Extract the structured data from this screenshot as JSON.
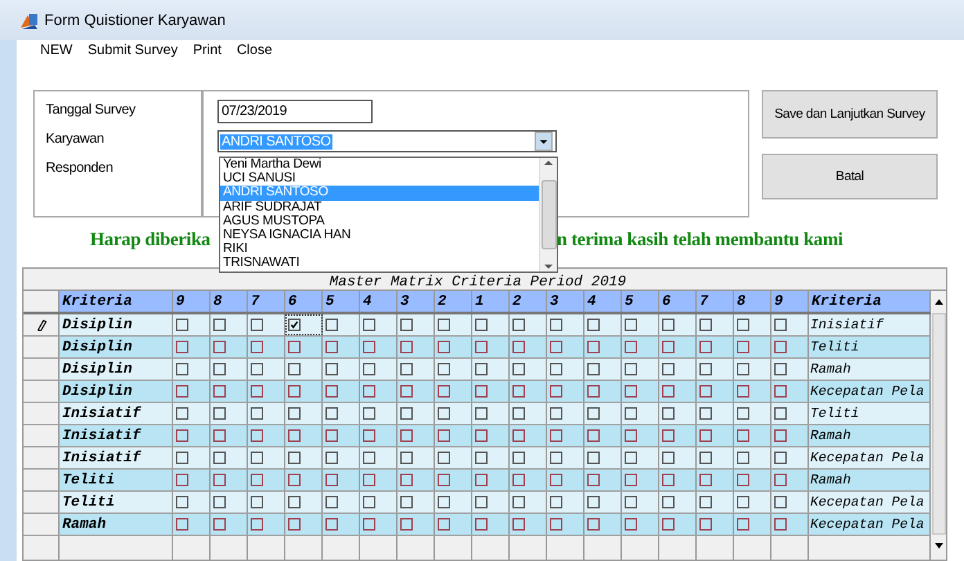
{
  "window": {
    "title": "Form Quistioner Karyawan"
  },
  "menu": [
    "NEW",
    "Submit Survey",
    "Print",
    "Close"
  ],
  "form": {
    "tanggal_survey": {
      "label": "Tanggal Survey",
      "value": "07/23/2019"
    },
    "karyawan": {
      "label": "Karyawan",
      "value": "ANDRI SANTOSO",
      "expanded": true,
      "options": [
        {
          "label": "Yeni Martha Dewi",
          "selected": false
        },
        {
          "label": "UCI SANUSI",
          "selected": false
        },
        {
          "label": "ANDRI SANTOSO",
          "selected": true
        },
        {
          "label": "ARIF SUDRAJAT",
          "selected": false
        },
        {
          "label": "AGUS MUSTOPA",
          "selected": false
        },
        {
          "label": "NEYSA IGNACIA HAN",
          "selected": false
        },
        {
          "label": "RIKI",
          "selected": false
        },
        {
          "label": "TRISNAWATI",
          "selected": false
        }
      ]
    },
    "responden": {
      "label": "Responden"
    }
  },
  "buttons": [
    "Save dan Lanjutkan Survey",
    "Batal"
  ],
  "message": [
    "Harap diberika",
    "n terima kasih telah membantu kami"
  ],
  "grid": {
    "title": "Master Matrix Criteria Period 2019",
    "columns": [
      "Kriteria",
      "9",
      "8",
      "7",
      "6",
      "5",
      "4",
      "3",
      "2",
      "1",
      "2",
      "3",
      "4",
      "5",
      "6",
      "7",
      "8",
      "9",
      "Kriteria"
    ],
    "rows": [
      {
        "left": "Disiplin",
        "right": "Inisiatif",
        "editing": true,
        "checks": [
          false,
          false,
          false,
          true,
          false,
          false,
          false,
          false,
          false,
          false,
          false,
          false,
          false,
          false,
          false,
          false,
          false
        ]
      },
      {
        "left": "Disiplin",
        "right": "Teliti",
        "editing": false,
        "checks": [
          false,
          false,
          false,
          false,
          false,
          false,
          false,
          false,
          false,
          false,
          false,
          false,
          false,
          false,
          false,
          false,
          false
        ]
      },
      {
        "left": "Disiplin",
        "right": "Ramah",
        "editing": false,
        "checks": [
          false,
          false,
          false,
          false,
          false,
          false,
          false,
          false,
          false,
          false,
          false,
          false,
          false,
          false,
          false,
          false,
          false
        ]
      },
      {
        "left": "Disiplin",
        "right": "Kecepatan Pela",
        "editing": false,
        "checks": [
          false,
          false,
          false,
          false,
          false,
          false,
          false,
          false,
          false,
          false,
          false,
          false,
          false,
          false,
          false,
          false,
          false
        ]
      },
      {
        "left": "Inisiatif",
        "right": "Teliti",
        "editing": false,
        "checks": [
          false,
          false,
          false,
          false,
          false,
          false,
          false,
          false,
          false,
          false,
          false,
          false,
          false,
          false,
          false,
          false,
          false
        ]
      },
      {
        "left": "Inisiatif",
        "right": "Ramah",
        "editing": false,
        "checks": [
          false,
          false,
          false,
          false,
          false,
          false,
          false,
          false,
          false,
          false,
          false,
          false,
          false,
          false,
          false,
          false,
          false
        ]
      },
      {
        "left": "Inisiatif",
        "right": "Kecepatan Pela",
        "editing": false,
        "checks": [
          false,
          false,
          false,
          false,
          false,
          false,
          false,
          false,
          false,
          false,
          false,
          false,
          false,
          false,
          false,
          false,
          false
        ]
      },
      {
        "left": "Teliti",
        "right": "Ramah",
        "editing": false,
        "checks": [
          false,
          false,
          false,
          false,
          false,
          false,
          false,
          false,
          false,
          false,
          false,
          false,
          false,
          false,
          false,
          false,
          false
        ]
      },
      {
        "left": "Teliti",
        "right": "Kecepatan Pela",
        "editing": false,
        "checks": [
          false,
          false,
          false,
          false,
          false,
          false,
          false,
          false,
          false,
          false,
          false,
          false,
          false,
          false,
          false,
          false,
          false
        ]
      },
      {
        "left": "Ramah",
        "right": "Kecepatan Pela",
        "editing": false,
        "checks": [
          false,
          false,
          false,
          false,
          false,
          false,
          false,
          false,
          false,
          false,
          false,
          false,
          false,
          false,
          false,
          false,
          false
        ]
      }
    ]
  }
}
